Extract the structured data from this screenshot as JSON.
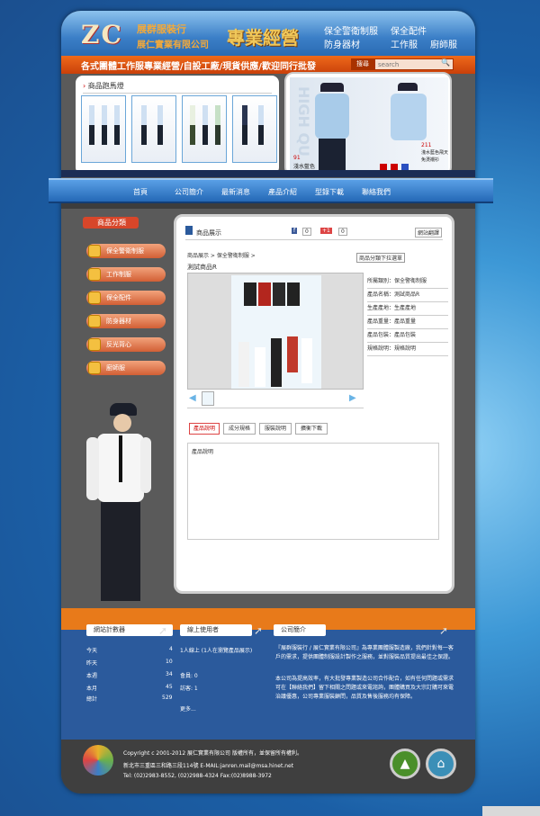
{
  "header": {
    "logo": "ZC",
    "company1": "展群服裝行",
    "company2": "展仁實業有限公司",
    "slogan": "專業經營",
    "services": [
      "保全警衛制服",
      "保全配件",
      "防身器材",
      "工作服",
      "廚師服"
    ]
  },
  "banner": {
    "tagline": "各式團體工作服專業經營/自設工廠/現貨供應/歡迎同行批發",
    "search_btn": "搜尋",
    "search_placeholder": "search"
  },
  "showcase": {
    "title": "商品跑馬燈",
    "photo_text": "HIGH QU",
    "label1": "91",
    "label1b": "淺水藍色",
    "label2": "211",
    "label2b": "淺水藍色飛天",
    "label2c": "免燙襯衫"
  },
  "nav": [
    "首頁",
    "公司簡介",
    "最新消息",
    "產品介紹",
    "型錄下載",
    "聯絡我們"
  ],
  "sidebar": {
    "header": "商品分類",
    "items": [
      "保全警衛制服",
      "工作制服",
      "保全配件",
      "防身器材",
      "反光背心",
      "廚師服"
    ]
  },
  "product": {
    "section_title": "商品展示",
    "share": [
      "0",
      "+1",
      "0"
    ],
    "lang": "網站翻譯",
    "breadcrumb": "商品展示 > 保全警衛制服 >",
    "name": "測試商品R",
    "select": "商品分類下拉選單",
    "specs": [
      {
        "k": "所屬類別",
        "v": "保全警衛制服"
      },
      {
        "k": "產品名稱",
        "v": "測試商品R"
      },
      {
        "k": "生產產地",
        "v": "生產產地"
      },
      {
        "k": "產品重量",
        "v": "產品重量"
      },
      {
        "k": "產品包裝",
        "v": "產品包裝"
      },
      {
        "k": "規格說明",
        "v": "規格說明"
      }
    ],
    "tabs": [
      "產品說明",
      "成分規格",
      "服裝說明",
      "擴衡下載"
    ],
    "desc": "產品說明"
  },
  "counter": {
    "title": "網站計數器",
    "rows": [
      [
        "今天",
        "4"
      ],
      [
        "昨天",
        "10"
      ],
      [
        "本週",
        "34"
      ],
      [
        "本月",
        "45"
      ],
      [
        "總計",
        "529"
      ]
    ]
  },
  "online": {
    "title": "線上使用者",
    "line1": "1人線上 (1人在瀏覽產品展示)",
    "line2": "會員: 0",
    "line3": "訪客: 1",
    "more": "更多..."
  },
  "about": {
    "title": "公司簡介",
    "para1": "『展群服裝行 / 展仁實業有限公司』為專業團體服製造廠，我們針對每一客戶的需求，提供團體制服設計製作之服務，並對服裝品質提出最佳之保證。",
    "para2": "本公司為提高效率，有大批發專業製造公司合作配合，如有任何問題或需求可在【聯絡我們】留下相關之問題或來電諮詢，團體購買及大宗訂購可來電治議優惠，公司專業服裝顧問，品質及售後服務均有保障。"
  },
  "footer": {
    "copyright": "Copyright c 2001-2012 展仁實業有限公司 版權所有，並保留所有權利。",
    "address": "新北市三重區三和路三段114號 E-MAIL:janren.mail@msa.hinet.net",
    "tel": "Tel: (02)2983-8552, (02)2988-4324 Fax:(02)8988-3972"
  },
  "colors": {
    "accent": "#e87a1a",
    "nav": "#2468b6",
    "frame": "#5a5a5a"
  }
}
